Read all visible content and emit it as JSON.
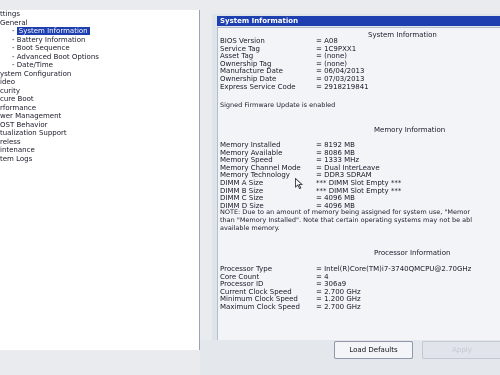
{
  "tree": [
    {
      "label": "ttings",
      "indent": 0
    },
    {
      "label": "General",
      "indent": 0
    },
    {
      "label": "System Information",
      "indent": 1,
      "selected": true
    },
    {
      "label": "Battery Information",
      "indent": 1
    },
    {
      "label": "Boot Sequence",
      "indent": 1
    },
    {
      "label": "Advanced Boot Options",
      "indent": 1
    },
    {
      "label": "Date/Time",
      "indent": 1
    },
    {
      "label": "ystem Configuration",
      "indent": 0
    },
    {
      "label": "ideo",
      "indent": 0
    },
    {
      "label": "curity",
      "indent": 0
    },
    {
      "label": "cure Boot",
      "indent": 0
    },
    {
      "label": "rformance",
      "indent": 0
    },
    {
      "label": "wer Management",
      "indent": 0
    },
    {
      "label": "OST Behavior",
      "indent": 0
    },
    {
      "label": "tualization Support",
      "indent": 0
    },
    {
      "label": "reless",
      "indent": 0
    },
    {
      "label": "intenance",
      "indent": 0
    },
    {
      "label": "tem Logs",
      "indent": 0
    }
  ],
  "panel_title": "System Information",
  "system": {
    "title": "System Information",
    "rows": [
      {
        "k": "BIOS Version",
        "v": "= A08"
      },
      {
        "k": "Service Tag",
        "v": "= 1C9PXX1"
      },
      {
        "k": "Asset Tag",
        "v": "= (none)"
      },
      {
        "k": "Ownership Tag",
        "v": "= (none)"
      },
      {
        "k": "Manufacture Date",
        "v": "= 06/04/2013"
      },
      {
        "k": "Ownership Date",
        "v": "= 07/03/2013"
      },
      {
        "k": "Express Service Code",
        "v": "= 2918219841"
      }
    ],
    "firmware": "Signed Firmware Update is enabled"
  },
  "memory": {
    "title": "Memory Information",
    "rows": [
      {
        "k": "Memory Installed",
        "v": "= 8192 MB"
      },
      {
        "k": "Memory Available",
        "v": "= 8086 MB"
      },
      {
        "k": "Memory Speed",
        "v": "= 1333 MHz"
      },
      {
        "k": "Memory Channel Mode",
        "v": "= Dual InterLeave"
      },
      {
        "k": "Memory Technology",
        "v": "= DDR3 SDRAM"
      },
      {
        "k": "DIMM A Size",
        "v": "*** DIMM Slot Empty ***"
      },
      {
        "k": "DIMM B Size",
        "v": "*** DIMM Slot Empty ***"
      },
      {
        "k": "DIMM C Size",
        "v": "= 4096 MB"
      },
      {
        "k": "DIMM D Size",
        "v": "= 4096 MB"
      }
    ],
    "note": [
      "NOTE: Due to an amount of memory being assigned for system use, \"Memor",
      "than \"Memory Installed\". Note that certain operating systems may not be abl",
      "available memory."
    ]
  },
  "processor": {
    "title": "Processor Information",
    "rows": [
      {
        "k": "Processor Type",
        "v": "= Intel(R)Core(TM)i7-3740QMCPU@2.70GHz"
      },
      {
        "k": "Core Count",
        "v": "= 4"
      },
      {
        "k": "Processor ID",
        "v": "= 306a9"
      },
      {
        "k": "Current Clock Speed",
        "v": "= 2.700 GHz"
      },
      {
        "k": "Minimum Clock Speed",
        "v": "= 1.200 GHz"
      },
      {
        "k": "Maximum Clock Speed",
        "v": "= 2.700 GHz"
      }
    ]
  },
  "buttons": {
    "load_defaults": "Load Defaults",
    "apply": "Apply"
  },
  "colors": {
    "selection": "#1e3fb0",
    "panel": "#dfe3ea"
  }
}
